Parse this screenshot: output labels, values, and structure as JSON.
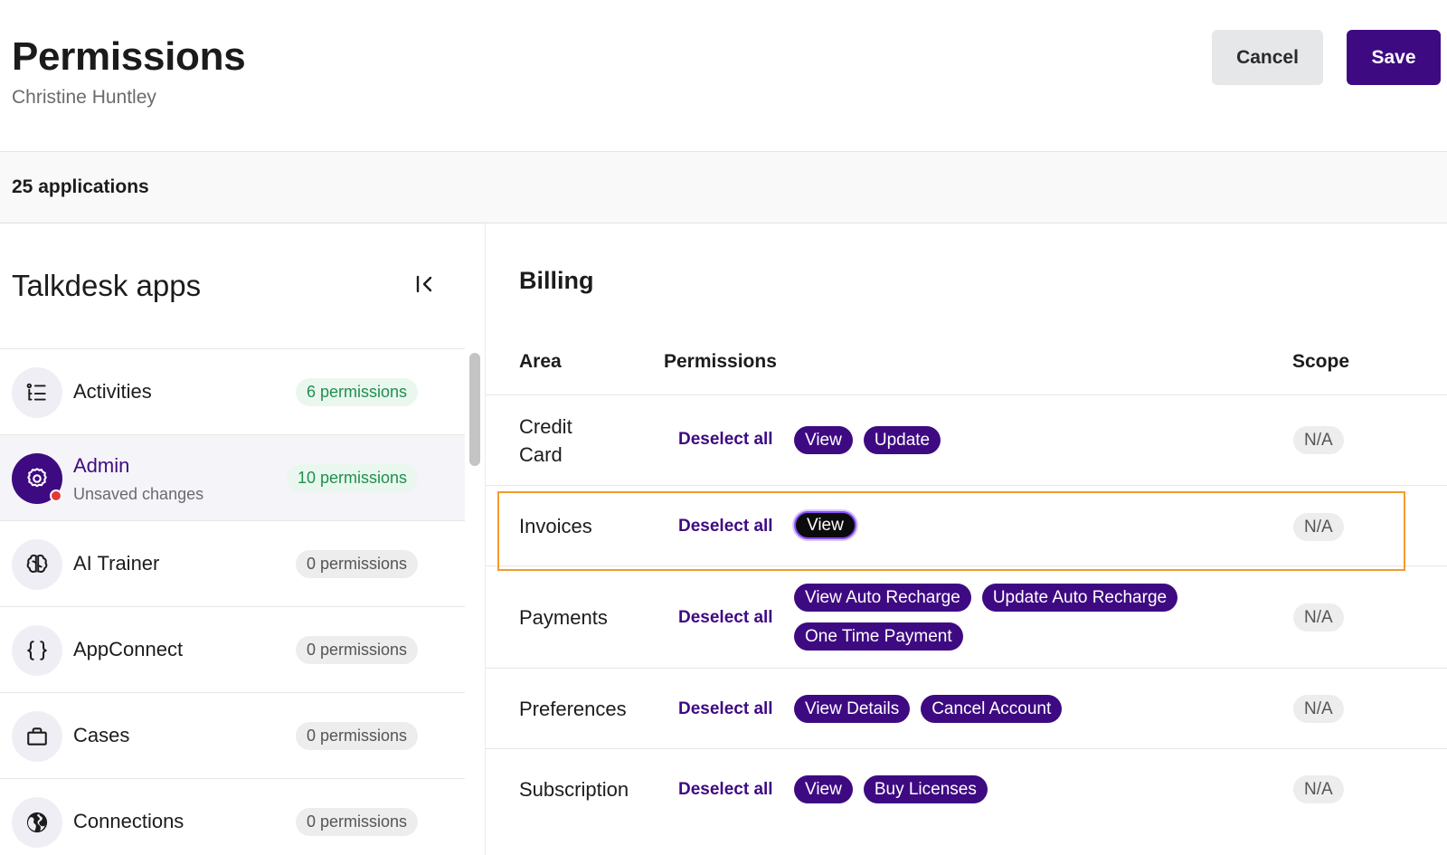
{
  "header": {
    "title": "Permissions",
    "subtitle": "Christine Huntley",
    "cancel_label": "Cancel",
    "save_label": "Save"
  },
  "apps_bar": {
    "count_label": "25 applications"
  },
  "sidebar": {
    "title": "Talkdesk apps",
    "collapse_icon": "collapse-left-icon",
    "items": [
      {
        "name": "Activities",
        "badge": "6 permissions",
        "icon": "list-icon",
        "selected": false
      },
      {
        "name": "Admin",
        "sub": "Unsaved changes",
        "badge": "10 permissions",
        "icon": "gear-icon",
        "selected": true
      },
      {
        "name": "AI Trainer",
        "badge": "0 permissions",
        "icon": "brain-icon",
        "selected": false
      },
      {
        "name": "AppConnect",
        "badge": "0 permissions",
        "icon": "braces-icon",
        "selected": false
      },
      {
        "name": "Cases",
        "badge": "0 permissions",
        "icon": "briefcase-icon",
        "selected": false
      },
      {
        "name": "Connections",
        "badge": "0 permissions",
        "icon": "globe-icon",
        "selected": false
      }
    ]
  },
  "main": {
    "section_title": "Billing",
    "columns": {
      "area": "Area",
      "permissions": "Permissions",
      "scope": "Scope"
    },
    "rows": [
      {
        "area": "Credit Card",
        "deselect": "Deselect all",
        "chips": [
          "View",
          "Update"
        ],
        "scope": "N/A"
      },
      {
        "area": "Invoices",
        "deselect": "Deselect all",
        "chips": [
          "View"
        ],
        "scope": "N/A"
      },
      {
        "area": "Payments",
        "deselect": "Deselect all",
        "chips": [
          "View Auto Recharge",
          "Update Auto Recharge",
          "One Time Payment"
        ],
        "scope": "N/A"
      },
      {
        "area": "Preferences",
        "deselect": "Deselect all",
        "chips": [
          "View Details",
          "Cancel Account"
        ],
        "scope": "N/A"
      },
      {
        "area": "Subscription",
        "deselect": "Deselect all",
        "chips": [
          "View",
          "Buy Licenses"
        ],
        "scope": "N/A"
      }
    ]
  },
  "colors": {
    "brand": "#3e0a82",
    "highlight": "#f39b2b",
    "success_badge": "#1f8f4e",
    "alert_dot": "#e53935"
  }
}
